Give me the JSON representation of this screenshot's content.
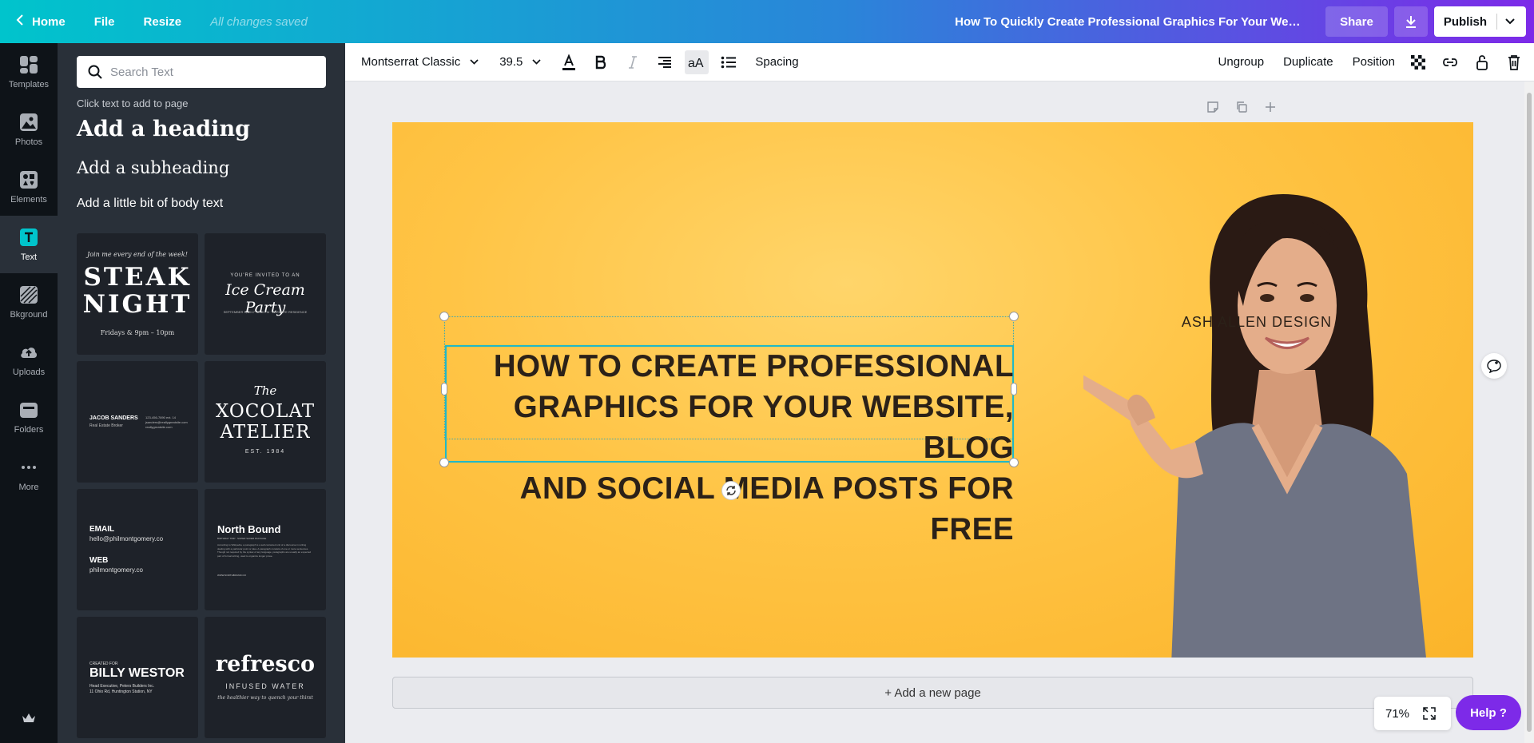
{
  "topbar": {
    "home_label": "Home",
    "file_label": "File",
    "resize_label": "Resize",
    "saved_status": "All changes saved",
    "doc_title": "How To Quickly Create Professional Graphics For Your Webs...",
    "share_label": "Share",
    "publish_label": "Publish",
    "gradient": [
      "#00c4cc",
      "#2a85d9",
      "#7d2ae8"
    ]
  },
  "rail": {
    "items": [
      {
        "label": "Templates",
        "icon": "templates-icon"
      },
      {
        "label": "Photos",
        "icon": "photos-icon"
      },
      {
        "label": "Elements",
        "icon": "elements-icon"
      },
      {
        "label": "Text",
        "icon": "text-icon",
        "active": true
      },
      {
        "label": "Bkground",
        "icon": "background-icon"
      },
      {
        "label": "Uploads",
        "icon": "uploads-icon"
      },
      {
        "label": "Folders",
        "icon": "folders-icon"
      },
      {
        "label": "More",
        "icon": "more-icon"
      }
    ],
    "accent": "#00c4cc"
  },
  "panel": {
    "search_placeholder": "Search Text",
    "hint": "Click text to add to page",
    "add_heading": "Add a heading",
    "add_subheading": "Add a subheading",
    "add_body": "Add a little bit of body text",
    "templates": {
      "steak": {
        "top": "Join me every end of the week!",
        "line1": "STEAK",
        "line2": "NIGHT",
        "bottom": "Fridays & 9pm – 10pm"
      },
      "icecream": {
        "top": "YOU'RE INVITED TO AN",
        "title": "Ice Cream Party",
        "bottom": "SEPTEMBER 7, 2017 · 3:00 PM · PARKLIFE RESIDENCE"
      },
      "jacob": {
        "name": "JACOB SANDERS",
        "role": "Real Estate Broker",
        "contact1": "123-456-7890 ext. 14",
        "contact2": "jsanders@reallygreatsite.com",
        "contact3": "reallygreatsite.com"
      },
      "xocolat": {
        "line1": "The",
        "line2": "XOCOLAT",
        "line3": "ATELIER",
        "line4": "EST. 1984"
      },
      "email": {
        "label1": "EMAIL",
        "value1": "hello@philmontgomery.co",
        "label2": "WEB",
        "value2": "philmontgomery.co"
      },
      "northbound": {
        "title": "North Bound",
        "subtitle": "BIRTHDAY TRIP · SUPER SAVER PACKAGE",
        "body": "According to Wikipedia, a paragraph is a self-contained unit of a discourse in writing dealing with a particular point or idea. A paragraph consists of one or more sentences. Though not required by the syntax of any language, paragraphs are usually an expected part of formal writing, used to organize longer prose.",
        "footer": "WWW.NORTHBOUND.CO"
      },
      "billy": {
        "top": "CREATED FOR",
        "name": "BILLY WESTOR",
        "line1": "Head Executive, Peters Builders Inc.",
        "line2": "11 Ohio Rd, Huntington Station, NY"
      },
      "refresco": {
        "title": "refresco",
        "subtitle": "INFUSED WATER",
        "tagline": "the healthier way to quench your thirst"
      }
    }
  },
  "toolbar": {
    "font": "Montserrat Classic",
    "size": "39.5",
    "spacing_label": "Spacing",
    "ungroup_label": "Ungroup",
    "duplicate_label": "Duplicate",
    "position_label": "Position"
  },
  "canvas": {
    "brand": "ASH ALLEN DESIGN",
    "headline_lines": [
      "HOW TO CREATE PROFESSIONAL",
      "GRAPHICS FOR YOUR WEBSITE, BLOG",
      "AND SOCIAL MEDIA POSTS FOR FREE"
    ],
    "background": "#ffc445",
    "text_color": "#2b2118",
    "selection_color": "#21b8c7"
  },
  "footer": {
    "add_page_label": "+ Add a new page",
    "zoom": "71%",
    "help_label": "Help ?"
  }
}
